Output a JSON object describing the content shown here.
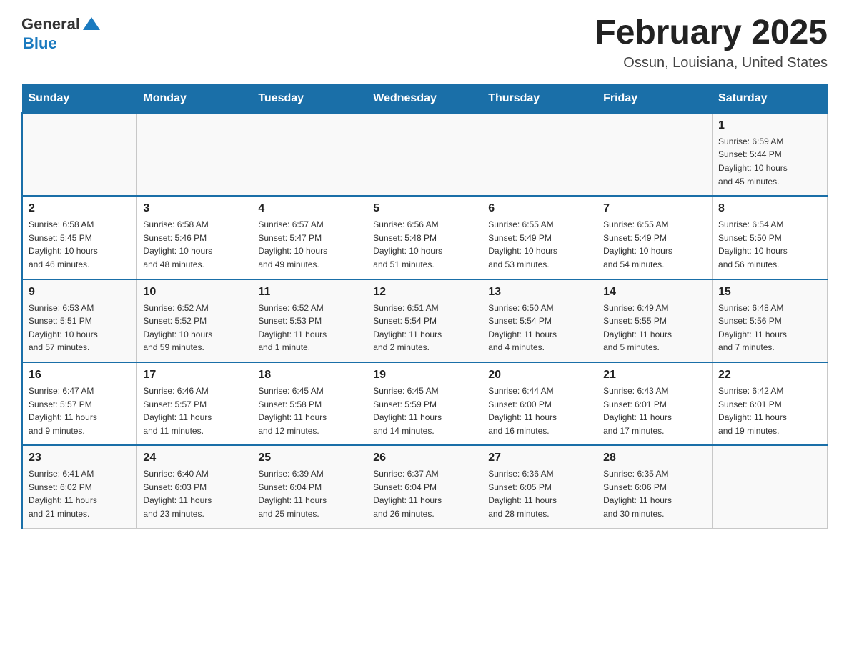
{
  "header": {
    "logo_general": "General",
    "logo_blue": "Blue",
    "title": "February 2025",
    "subtitle": "Ossun, Louisiana, United States"
  },
  "days_of_week": [
    "Sunday",
    "Monday",
    "Tuesday",
    "Wednesday",
    "Thursday",
    "Friday",
    "Saturday"
  ],
  "weeks": [
    [
      {
        "day": "",
        "info": ""
      },
      {
        "day": "",
        "info": ""
      },
      {
        "day": "",
        "info": ""
      },
      {
        "day": "",
        "info": ""
      },
      {
        "day": "",
        "info": ""
      },
      {
        "day": "",
        "info": ""
      },
      {
        "day": "1",
        "info": "Sunrise: 6:59 AM\nSunset: 5:44 PM\nDaylight: 10 hours\nand 45 minutes."
      }
    ],
    [
      {
        "day": "2",
        "info": "Sunrise: 6:58 AM\nSunset: 5:45 PM\nDaylight: 10 hours\nand 46 minutes."
      },
      {
        "day": "3",
        "info": "Sunrise: 6:58 AM\nSunset: 5:46 PM\nDaylight: 10 hours\nand 48 minutes."
      },
      {
        "day": "4",
        "info": "Sunrise: 6:57 AM\nSunset: 5:47 PM\nDaylight: 10 hours\nand 49 minutes."
      },
      {
        "day": "5",
        "info": "Sunrise: 6:56 AM\nSunset: 5:48 PM\nDaylight: 10 hours\nand 51 minutes."
      },
      {
        "day": "6",
        "info": "Sunrise: 6:55 AM\nSunset: 5:49 PM\nDaylight: 10 hours\nand 53 minutes."
      },
      {
        "day": "7",
        "info": "Sunrise: 6:55 AM\nSunset: 5:49 PM\nDaylight: 10 hours\nand 54 minutes."
      },
      {
        "day": "8",
        "info": "Sunrise: 6:54 AM\nSunset: 5:50 PM\nDaylight: 10 hours\nand 56 minutes."
      }
    ],
    [
      {
        "day": "9",
        "info": "Sunrise: 6:53 AM\nSunset: 5:51 PM\nDaylight: 10 hours\nand 57 minutes."
      },
      {
        "day": "10",
        "info": "Sunrise: 6:52 AM\nSunset: 5:52 PM\nDaylight: 10 hours\nand 59 minutes."
      },
      {
        "day": "11",
        "info": "Sunrise: 6:52 AM\nSunset: 5:53 PM\nDaylight: 11 hours\nand 1 minute."
      },
      {
        "day": "12",
        "info": "Sunrise: 6:51 AM\nSunset: 5:54 PM\nDaylight: 11 hours\nand 2 minutes."
      },
      {
        "day": "13",
        "info": "Sunrise: 6:50 AM\nSunset: 5:54 PM\nDaylight: 11 hours\nand 4 minutes."
      },
      {
        "day": "14",
        "info": "Sunrise: 6:49 AM\nSunset: 5:55 PM\nDaylight: 11 hours\nand 5 minutes."
      },
      {
        "day": "15",
        "info": "Sunrise: 6:48 AM\nSunset: 5:56 PM\nDaylight: 11 hours\nand 7 minutes."
      }
    ],
    [
      {
        "day": "16",
        "info": "Sunrise: 6:47 AM\nSunset: 5:57 PM\nDaylight: 11 hours\nand 9 minutes."
      },
      {
        "day": "17",
        "info": "Sunrise: 6:46 AM\nSunset: 5:57 PM\nDaylight: 11 hours\nand 11 minutes."
      },
      {
        "day": "18",
        "info": "Sunrise: 6:45 AM\nSunset: 5:58 PM\nDaylight: 11 hours\nand 12 minutes."
      },
      {
        "day": "19",
        "info": "Sunrise: 6:45 AM\nSunset: 5:59 PM\nDaylight: 11 hours\nand 14 minutes."
      },
      {
        "day": "20",
        "info": "Sunrise: 6:44 AM\nSunset: 6:00 PM\nDaylight: 11 hours\nand 16 minutes."
      },
      {
        "day": "21",
        "info": "Sunrise: 6:43 AM\nSunset: 6:01 PM\nDaylight: 11 hours\nand 17 minutes."
      },
      {
        "day": "22",
        "info": "Sunrise: 6:42 AM\nSunset: 6:01 PM\nDaylight: 11 hours\nand 19 minutes."
      }
    ],
    [
      {
        "day": "23",
        "info": "Sunrise: 6:41 AM\nSunset: 6:02 PM\nDaylight: 11 hours\nand 21 minutes."
      },
      {
        "day": "24",
        "info": "Sunrise: 6:40 AM\nSunset: 6:03 PM\nDaylight: 11 hours\nand 23 minutes."
      },
      {
        "day": "25",
        "info": "Sunrise: 6:39 AM\nSunset: 6:04 PM\nDaylight: 11 hours\nand 25 minutes."
      },
      {
        "day": "26",
        "info": "Sunrise: 6:37 AM\nSunset: 6:04 PM\nDaylight: 11 hours\nand 26 minutes."
      },
      {
        "day": "27",
        "info": "Sunrise: 6:36 AM\nSunset: 6:05 PM\nDaylight: 11 hours\nand 28 minutes."
      },
      {
        "day": "28",
        "info": "Sunrise: 6:35 AM\nSunset: 6:06 PM\nDaylight: 11 hours\nand 30 minutes."
      },
      {
        "day": "",
        "info": ""
      }
    ]
  ]
}
